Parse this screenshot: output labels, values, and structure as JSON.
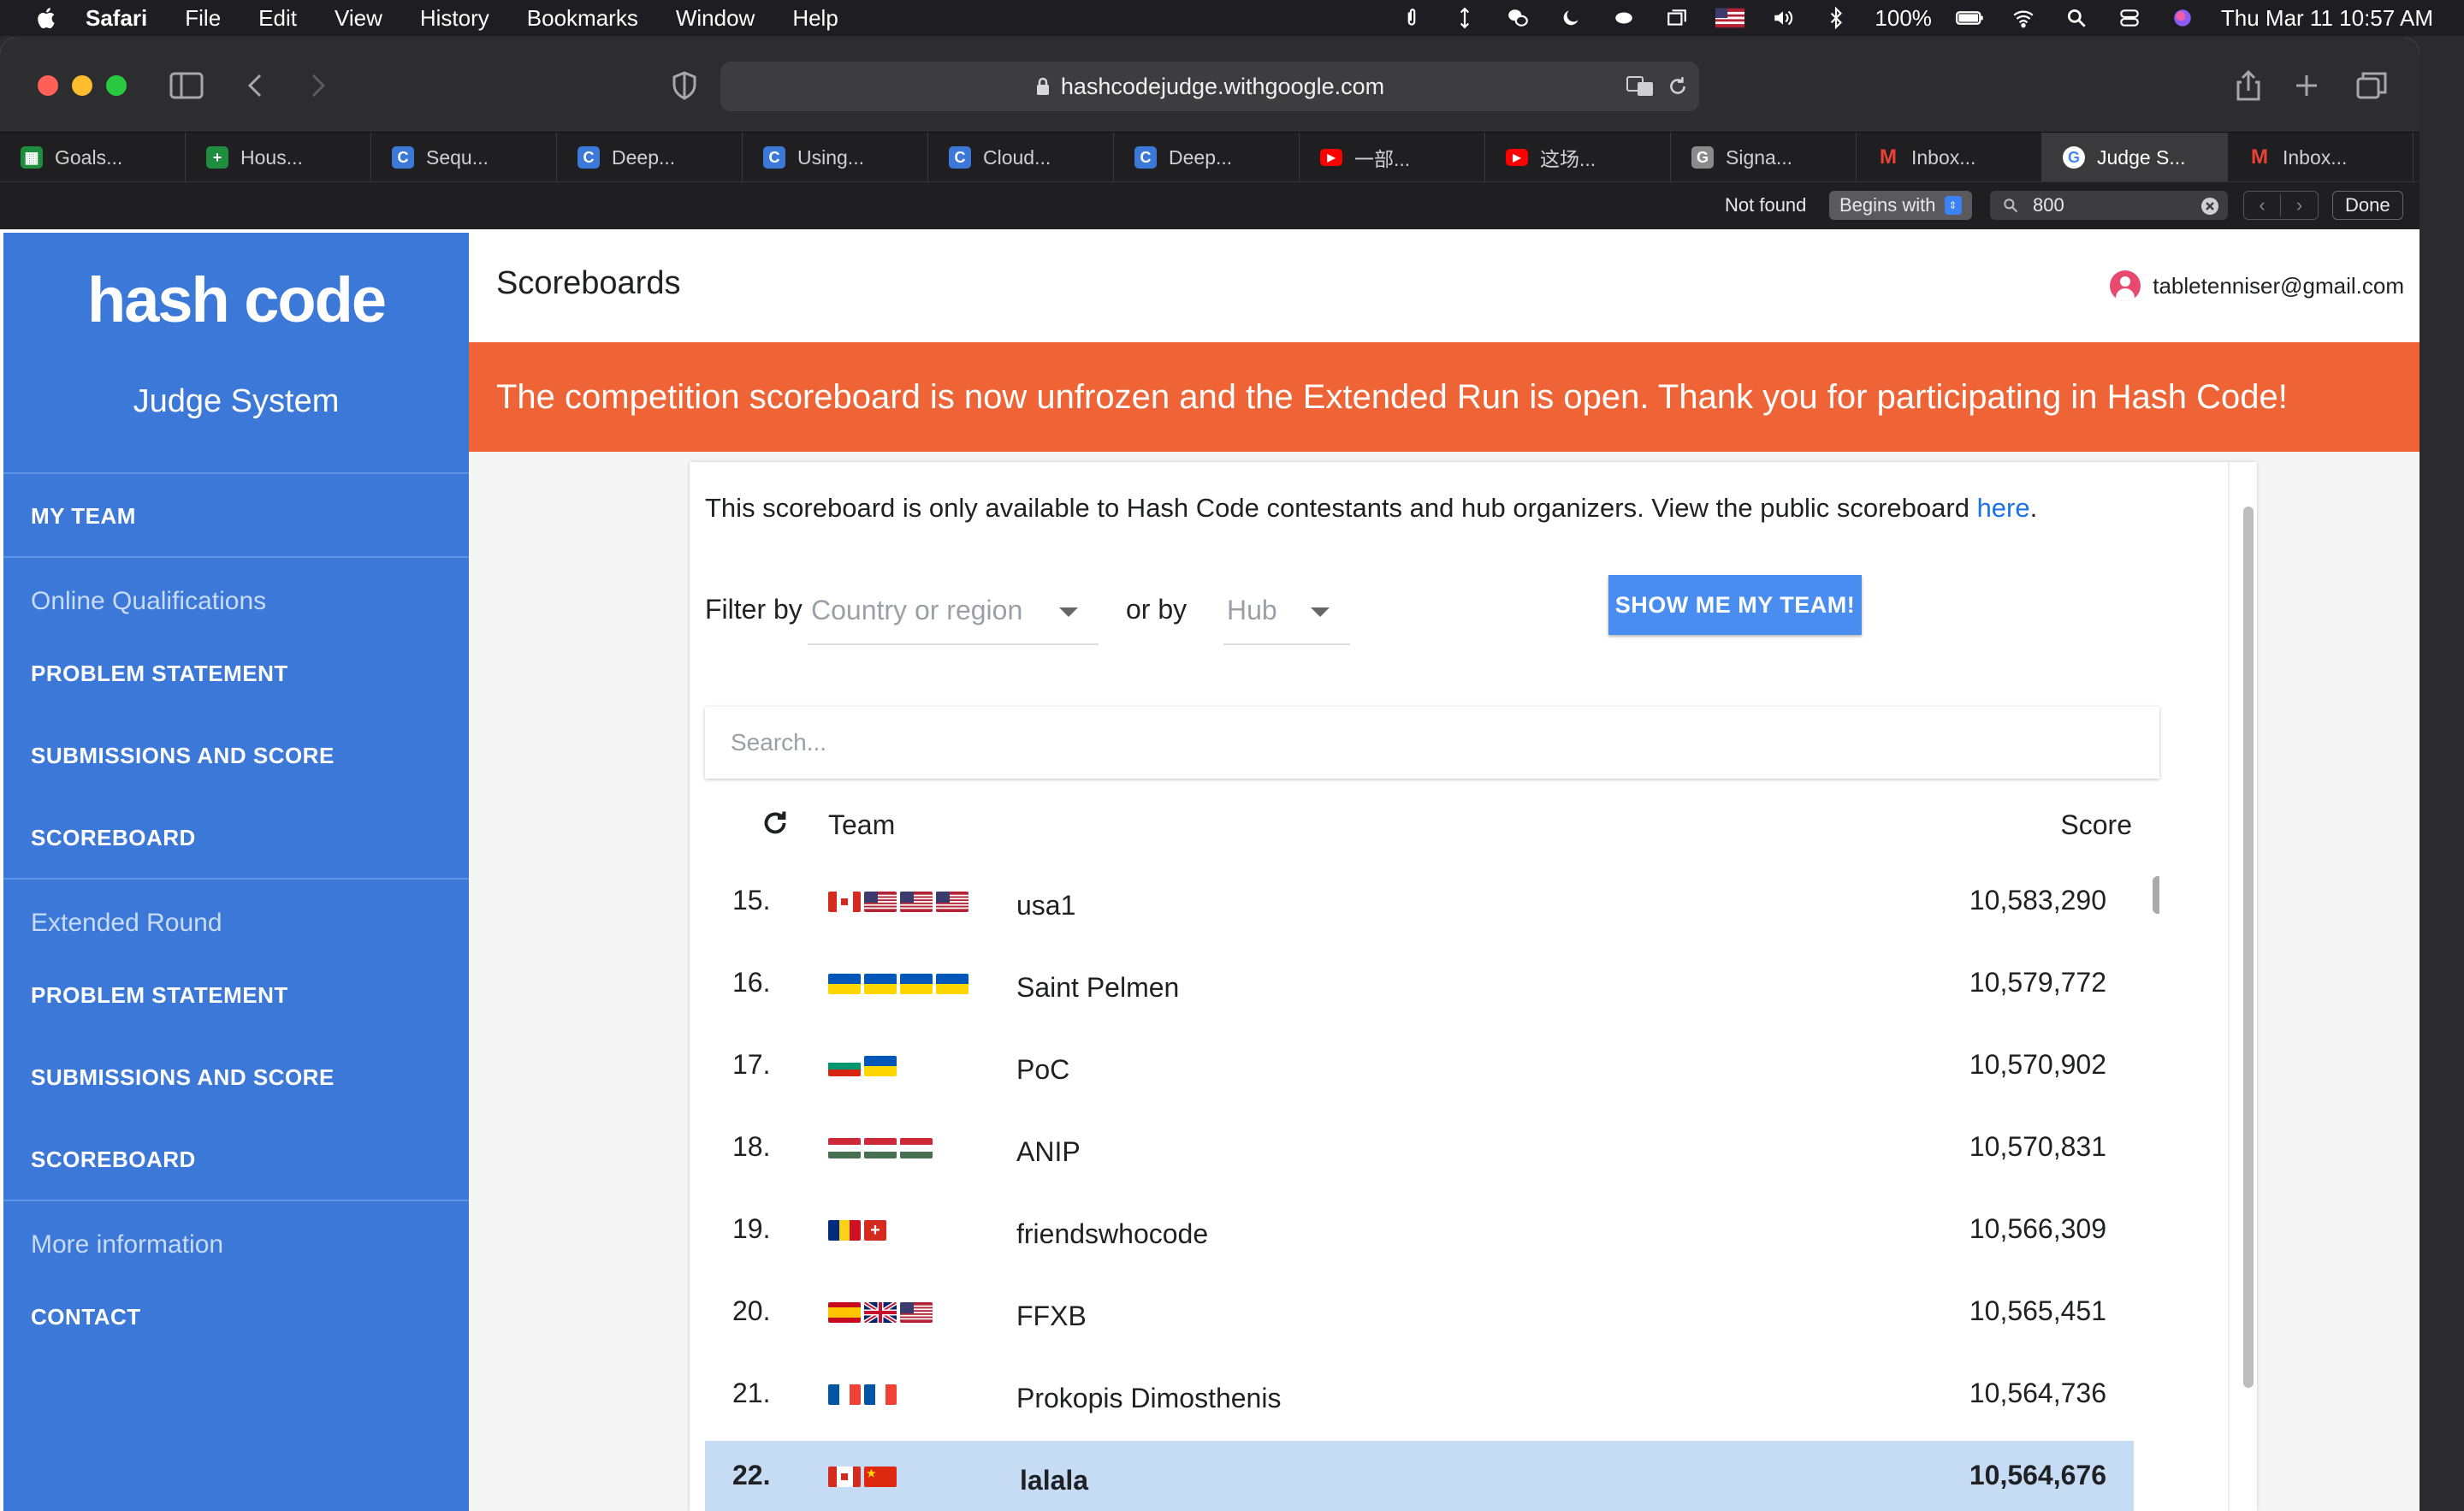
{
  "menubar": {
    "app": "Safari",
    "items": [
      "File",
      "Edit",
      "View",
      "History",
      "Bookmarks",
      "Window",
      "Help"
    ],
    "battery": "100%",
    "datetime": "Thu Mar 11  10:57 AM"
  },
  "browser": {
    "url": "hashcodejudge.withgoogle.com",
    "tabs": [
      {
        "label": "Goals...",
        "icon": "sheets-icon",
        "color": "#1e8e3e"
      },
      {
        "label": "Hous...",
        "icon": "sheets-plus-icon",
        "color": "#1e8e3e"
      },
      {
        "label": "Sequ...",
        "icon": "c-icon",
        "color": "#3b78d8"
      },
      {
        "label": "Deep...",
        "icon": "c-icon",
        "color": "#3b78d8"
      },
      {
        "label": "Using...",
        "icon": "c-icon",
        "color": "#3b78d8"
      },
      {
        "label": "Cloud...",
        "icon": "c-icon",
        "color": "#3b78d8"
      },
      {
        "label": "Deep...",
        "icon": "c-icon",
        "color": "#3b78d8"
      },
      {
        "label": "一部...",
        "icon": "youtube-icon",
        "color": "#ff0000"
      },
      {
        "label": "这场...",
        "icon": "youtube-icon",
        "color": "#ff0000"
      },
      {
        "label": "Signa...",
        "icon": "g-icon",
        "color": "#8a8a8a"
      },
      {
        "label": "Inbox...",
        "icon": "gmail-icon",
        "color": "#ea4335"
      },
      {
        "label": "Judge S...",
        "icon": "google-icon",
        "color": "#ffffff"
      },
      {
        "label": "Inbox...",
        "icon": "gmail-icon",
        "color": "#ea4335"
      }
    ],
    "active_tab": 11,
    "find": {
      "status": "Not found",
      "mode": "Begins with",
      "query": "800",
      "done": "Done"
    }
  },
  "sidebar": {
    "logo": "hash code",
    "subtitle": "Judge System",
    "my_team": "MY TEAM",
    "section1": "Online Qualifications",
    "s1_problem": "PROBLEM STATEMENT",
    "s1_submissions": "SUBMISSIONS AND SCORE",
    "s1_scoreboard": "SCOREBOARD",
    "section2": "Extended Round",
    "s2_problem": "PROBLEM STATEMENT",
    "s2_submissions": "SUBMISSIONS AND SCORE",
    "s2_scoreboard": "SCOREBOARD",
    "section3": "More information",
    "contact": "CONTACT"
  },
  "header": {
    "title": "Scoreboards",
    "user": "tabletenniser@gmail.com"
  },
  "banner": "The competition scoreboard is now unfrozen and the Extended Run is open. Thank you for participating in Hash Code!",
  "scoreboard": {
    "info_text": "This scoreboard is only available to Hash Code contestants and hub organizers. View the public scoreboard ",
    "info_link": "here",
    "filter_label": "Filter by",
    "country_placeholder": "Country or region",
    "or_by": "or by",
    "hub_placeholder": "Hub",
    "show_team_button": "SHOW ME MY TEAM!",
    "search_placeholder": "Search...",
    "col_team": "Team",
    "col_score": "Score",
    "rows": [
      {
        "rank": "15.",
        "team": "usa1",
        "score": "10,583,290",
        "flags": [
          "ca",
          "us",
          "us",
          "us"
        ]
      },
      {
        "rank": "16.",
        "team": "Saint Pelmen",
        "score": "10,579,772",
        "flags": [
          "ua",
          "ua",
          "ua",
          "ua"
        ]
      },
      {
        "rank": "17.",
        "team": "PoC",
        "score": "10,570,902",
        "flags": [
          "bg",
          "ua"
        ]
      },
      {
        "rank": "18.",
        "team": "ANIP",
        "score": "10,570,831",
        "flags": [
          "hu",
          "hu",
          "hu"
        ]
      },
      {
        "rank": "19.",
        "team": "friendswhocode",
        "score": "10,566,309",
        "flags": [
          "ro",
          "ch"
        ]
      },
      {
        "rank": "20.",
        "team": "FFXB",
        "score": "10,565,451",
        "flags": [
          "es",
          "gb",
          "us"
        ]
      },
      {
        "rank": "21.",
        "team": "Prokopis Dimosthenis",
        "score": "10,564,736",
        "flags": [
          "fr",
          "fr"
        ]
      },
      {
        "rank": "22.",
        "team": "lalala",
        "score": "10,564,676",
        "flags": [
          "ca",
          "cn"
        ],
        "highlighted": true
      }
    ]
  },
  "colors": {
    "sidebar": "#3b78d8",
    "banner": "#ef6436",
    "button": "#4a8df0",
    "highlight_row": "#c6dcf5"
  }
}
